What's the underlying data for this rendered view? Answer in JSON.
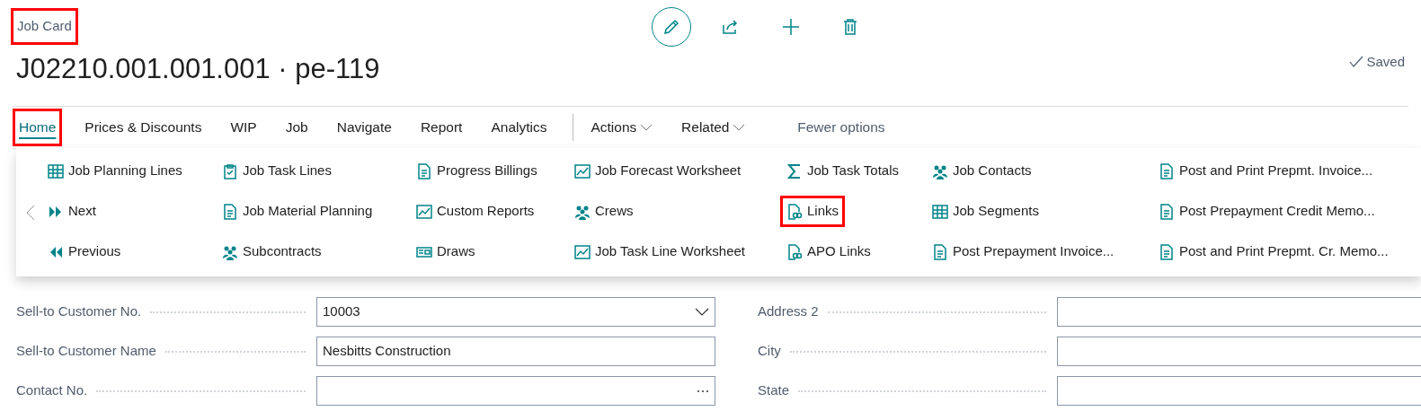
{
  "page": {
    "caption": "Job Card",
    "caption_highlighted": true,
    "title": "J02210.001.001.001 · pe-119",
    "status": "Saved"
  },
  "nav": [
    {
      "label": "Home",
      "kind": "tab",
      "selected": true,
      "highlighted": true
    },
    {
      "label": "Prices & Discounts",
      "kind": "tab",
      "selected": false,
      "highlighted": false
    },
    {
      "label": "WIP",
      "kind": "tab",
      "selected": false,
      "highlighted": false
    },
    {
      "label": "Job",
      "kind": "tab",
      "selected": false,
      "highlighted": false
    },
    {
      "label": "Navigate",
      "kind": "tab",
      "selected": false,
      "highlighted": false
    },
    {
      "label": "Report",
      "kind": "tab",
      "selected": false,
      "highlighted": false
    },
    {
      "label": "Analytics",
      "kind": "tab",
      "selected": false,
      "highlighted": false
    },
    {
      "label": "Actions",
      "kind": "menu",
      "selected": false,
      "highlighted": false
    },
    {
      "label": "Related",
      "kind": "menu",
      "selected": false,
      "highlighted": false
    },
    {
      "label": "Fewer options",
      "kind": "toggle",
      "selected": false,
      "highlighted": false
    }
  ],
  "actions_menu": {
    "columns": [
      [
        {
          "label": "Job Planning Lines",
          "highlighted": false
        },
        {
          "label": "Next",
          "highlighted": false
        },
        {
          "label": "Previous",
          "highlighted": false
        }
      ],
      [
        {
          "label": "Job Task Lines",
          "highlighted": false
        },
        {
          "label": "Job Material Planning",
          "highlighted": false
        },
        {
          "label": "Subcontracts",
          "highlighted": false
        }
      ],
      [
        {
          "label": "Progress Billings",
          "highlighted": false
        },
        {
          "label": "Custom Reports",
          "highlighted": false
        },
        {
          "label": "Draws",
          "highlighted": false
        }
      ],
      [
        {
          "label": "Job Forecast Worksheet",
          "highlighted": false
        },
        {
          "label": "Crews",
          "highlighted": false
        },
        {
          "label": "Job Task Line Worksheet",
          "highlighted": false
        }
      ],
      [
        {
          "label": "Job Task Totals",
          "highlighted": false
        },
        {
          "label": "Links",
          "highlighted": true
        },
        {
          "label": "APO Links",
          "highlighted": false
        }
      ],
      [
        {
          "label": "Job Contacts",
          "highlighted": false
        },
        {
          "label": "Job Segments",
          "highlighted": false
        },
        {
          "label": "Post Prepayment Invoice...",
          "highlighted": false
        }
      ],
      [
        {
          "label": "Post and Print Prepmt. Invoice...",
          "highlighted": false
        },
        {
          "label": "Post Prepayment Credit Memo...",
          "highlighted": false
        },
        {
          "label": "Post and Print Prepmt. Cr. Memo...",
          "highlighted": false
        }
      ]
    ]
  },
  "form": {
    "left": [
      {
        "label": "Sell-to Customer No.",
        "value": "10003",
        "kind": "dropdown"
      },
      {
        "label": "Sell-to Customer Name",
        "value": "Nesbitts Construction",
        "kind": "text"
      },
      {
        "label": "Contact No.",
        "kind": "lookup"
      }
    ],
    "right": [
      {
        "label": "Address 2",
        "kind": "text"
      },
      {
        "label": "City",
        "kind": "text"
      },
      {
        "label": "State",
        "kind": "text"
      }
    ]
  }
}
